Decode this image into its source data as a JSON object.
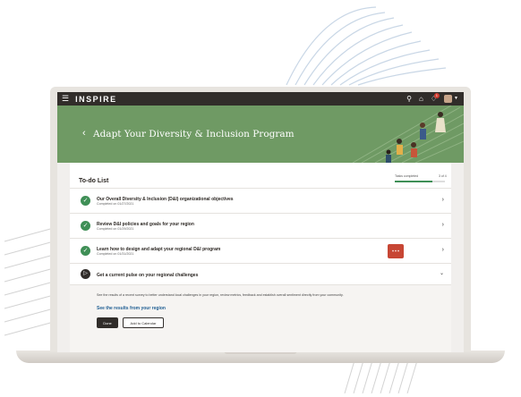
{
  "app": {
    "logo": "INSPIRE",
    "notification_count": "1"
  },
  "hero": {
    "title": "Adapt Your Diversity & Inclusion Program"
  },
  "todo": {
    "title": "To-do List",
    "tasks_label": "Tasks completed",
    "tasks_count": "3 of 4",
    "progress": 0.75,
    "items": [
      {
        "title": "Our Overall Diversity & Inclusion (D&I) organizational objectives",
        "subtitle": "Completed on 01/27/2021",
        "status": "completed"
      },
      {
        "title": "Review D&I policies and goals for your region",
        "subtitle": "Completed on 01/29/2021",
        "status": "completed"
      },
      {
        "title": "Learn how to design and adapt your regional D&I program",
        "subtitle": "Completed on 01/31/2021",
        "status": "completed"
      },
      {
        "title": "Get a current pulse on your regional challenges",
        "subtitle": "",
        "status": "expanded"
      }
    ],
    "expanded": {
      "description": "See the results of a recent survey to better understand local challenges in your region, review metrics, feedback and establish overall sentiment directly from your community.",
      "link": "See the results from your region",
      "done_label": "Done",
      "calendar_label": "Add to Calendar"
    }
  },
  "colors": {
    "topbar": "#312d2a",
    "hero": "#6f9a64",
    "accent_green": "#3f8f56",
    "link_blue": "#1f5e93",
    "chat_red": "#c74634"
  },
  "icons": {
    "menu": "hamburger-menu-icon",
    "search": "search-icon",
    "home": "home-icon",
    "notifications": "bell-icon",
    "back": "chevron-left-icon",
    "completed": "check-circle-icon",
    "active": "play-circle-icon",
    "row_arrow": "chevron-right-icon",
    "expand": "chevron-down-icon",
    "chat": "chat-icon"
  }
}
